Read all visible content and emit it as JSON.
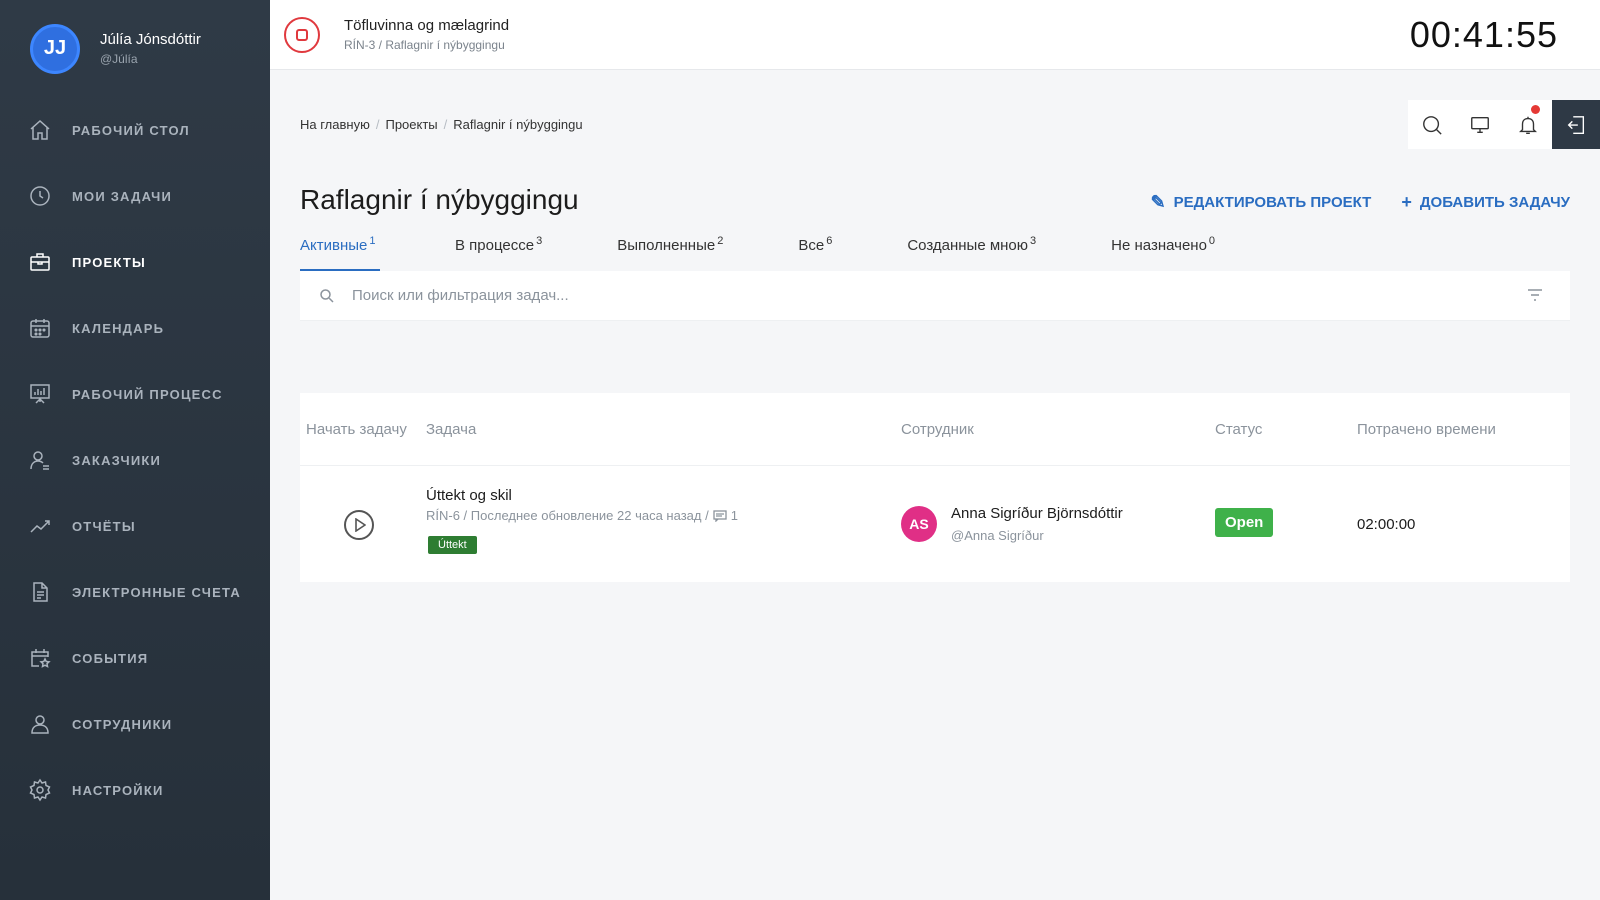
{
  "user": {
    "initials": "JJ",
    "name": "Júlía Jónsdóttir",
    "handle": "@Júlía"
  },
  "sidebar": {
    "items": [
      {
        "label": "РАБОЧИЙ СТОЛ",
        "icon": "home-icon"
      },
      {
        "label": "МОИ ЗАДАЧИ",
        "icon": "clock-icon"
      },
      {
        "label": "ПРОЕКТЫ",
        "icon": "briefcase-icon",
        "active": true
      },
      {
        "label": "КАЛЕНДАРЬ",
        "icon": "calendar-icon"
      },
      {
        "label": "РАБОЧИЙ ПРОЦЕСС",
        "icon": "presentation-icon"
      },
      {
        "label": "ЗАКАЗЧИКИ",
        "icon": "customer-icon"
      },
      {
        "label": "ОТЧЁТЫ",
        "icon": "chart-line-icon"
      },
      {
        "label": "ЭЛЕКТРОННЫЕ СЧЕТА",
        "icon": "document-icon"
      },
      {
        "label": "СОБЫТИЯ",
        "icon": "calendar-star-icon"
      },
      {
        "label": "СОТРУДНИКИ",
        "icon": "users-icon"
      },
      {
        "label": "НАСТРОЙКИ",
        "icon": "gear-icon"
      }
    ]
  },
  "timer": {
    "title": "Töfluvinna og mælagrind",
    "subtitle": "RÍN-3 / Raflagnir í nýbyggingu",
    "clock": "00:41:55"
  },
  "breadcrumb": {
    "home": "На главную",
    "projects": "Проекты",
    "current": "Raflagnir í nýbyggingu"
  },
  "page": {
    "title": "Raflagnir í nýbyggingu",
    "edit_label": "РЕДАКТИРОВАТЬ ПРОЕКТ",
    "add_label": "ДОБАВИТЬ ЗАДАЧУ"
  },
  "tabs": [
    {
      "label": "Активные",
      "count": "1",
      "active": true
    },
    {
      "label": "В процессе",
      "count": "3"
    },
    {
      "label": "Выполненные",
      "count": "2"
    },
    {
      "label": "Все",
      "count": "6"
    },
    {
      "label": "Созданные мною",
      "count": "3"
    },
    {
      "label": "Не назначено",
      "count": "0"
    }
  ],
  "search": {
    "placeholder": "Поиск или фильтрация задач..."
  },
  "table": {
    "headers": {
      "start": "Начать задачу",
      "task": "Задача",
      "employee": "Сотрудник",
      "status": "Статус",
      "time": "Потрачено времени"
    },
    "rows": [
      {
        "title": "Úttekt og skil",
        "meta": "RÍN-6 / Последнее обновление 22 часа назад /",
        "comments": "1",
        "tag": "Úttekt",
        "employee_initials": "AS",
        "employee_name": "Anna Sigríður Björnsdóttir",
        "employee_handle": "@Anna Sigríður",
        "status": "Open",
        "time_spent": "02:00:00"
      }
    ]
  },
  "colors": {
    "accent": "#2a6dc1",
    "sidebar": "#2f3a46",
    "status_open": "#3fb14a",
    "tag": "#2e7d32",
    "stop": "#e0393e"
  }
}
